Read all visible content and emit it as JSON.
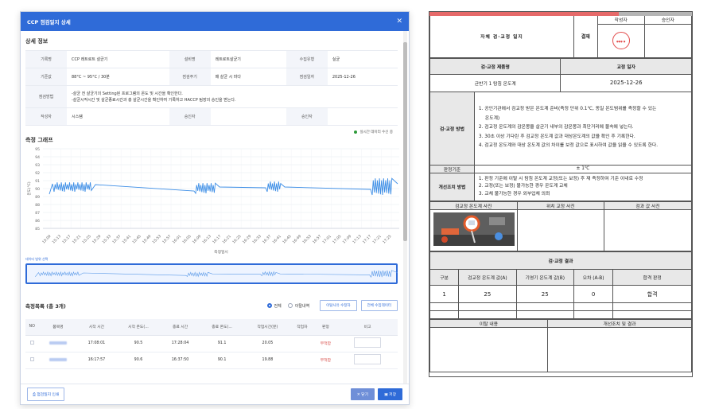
{
  "modal": {
    "title": "CCP 점검일지 상세",
    "close_icon": "close-icon",
    "detail_section": "상세 정보",
    "info": {
      "row1": [
        {
          "label": "기록명",
          "value": "CCP 레트로트 살균기"
        },
        {
          "label": "설비명",
          "value": "레트로트살균기"
        },
        {
          "label": "수집유형",
          "value": "실균"
        }
      ],
      "row2": [
        {
          "label": "기준값",
          "value": "88°C ~ 95°C / 30분"
        },
        {
          "label": "점검주기",
          "value": "매 살균 시 마다"
        },
        {
          "label": "점검일자",
          "value": "2025-12-26"
        }
      ],
      "row3": {
        "label": "점검방법",
        "lines": [
          "-살균 전 살균기의 Setting된 프로그램의 온도 및 시간을 확인한다.",
          "-살균시작시간 및 살균종료시간과 총 살균시간을 확인하여 기록하고 HACCP 팀장의 승인을 받는다."
        ]
      },
      "row4": [
        {
          "label": "작성자",
          "value": "시스템"
        },
        {
          "label": "승인자",
          "value": ""
        },
        {
          "label": "승인자",
          "value": ""
        }
      ]
    },
    "live_legend": "실시간 데이터 수신 중",
    "chart_section": "측정 그래프",
    "navigator_label": "데이터 범위 선택",
    "records_title": "측정목록 (총 3개)",
    "radio_all": "전체",
    "radio_abnormal": "이탈내역",
    "btn_abnormal_fix": "이탈사유 수정하",
    "btn_all_data": "전체 수집데이터",
    "table": {
      "headers": [
        "NO",
        "품목명",
        "시작 시간",
        "시작 온도(...",
        "종료 시간",
        "종료 온도(...",
        "작업시간(분)",
        "작업자",
        "판정",
        "비고"
      ],
      "rows": [
        {
          "start": "17:08:01",
          "start_temp": "90.5",
          "end": "17:28:04",
          "end_temp": "91.1",
          "minutes": "20.05",
          "worker": "",
          "result": "부적합"
        },
        {
          "start": "16:17:57",
          "start_temp": "90.6",
          "end": "16:37:50",
          "end_temp": "90.1",
          "minutes": "19.88",
          "worker": "",
          "result": "부적합"
        }
      ]
    },
    "footer": {
      "print": "점검일지 인쇄",
      "close": "✕ 닫기",
      "save": "저장"
    }
  },
  "chart_data": {
    "type": "line",
    "title": "",
    "xlabel": "측정일시",
    "ylabel": "온도(°C)",
    "ylim": [
      85,
      95
    ],
    "yticks": [
      85,
      86,
      87,
      88,
      89,
      90,
      91,
      92,
      93,
      94,
      95
    ],
    "x_ticks": [
      "15:09",
      "15:13",
      "15:17",
      "15:21",
      "15:25",
      "15:29",
      "15:33",
      "15:37",
      "15:41",
      "15:45",
      "15:49",
      "15:53",
      "15:57",
      "16:01",
      "16:05",
      "16:09",
      "16:13",
      "16:17",
      "16:21",
      "16:25",
      "16:29",
      "16:33",
      "16:37",
      "16:41",
      "16:45",
      "16:49",
      "16:53",
      "16:57",
      "17:01",
      "17:05",
      "17:09",
      "17:13",
      "17:17",
      "17:21",
      "17:25"
    ],
    "series": [
      {
        "name": "",
        "color": "#3d8ee6"
      }
    ],
    "grid": true
  },
  "document": {
    "title": "자체 검·교정 일지",
    "approval_label": "결재",
    "writer_label": "작성자",
    "approver_label": "승인자",
    "product_label": "검·교정 제품명",
    "date_label": "교정 일자",
    "product": "균반기 1 탐침 온도계",
    "date": "2025-12-26",
    "method_label": "검·교정 방법",
    "method_lines": [
      "1. 공인기관에서 검교정 받은 온도계 준비(측정 단위 0.1℃, 동일 온도범위를 측정할 수 있는",
      "온도계)",
      "2. 검교정 온도계의 감온봉을 살균기 내부의 감온봉과 최단거리에 물속에 넣는다.",
      "3. 30초 이상 기다린 후 검교정 온도계 값과 대상온도계의 값을 확인 후 기록한다.",
      "4. 검교정 온도계와 대상 온도계 값의 차이를 보정 값으로 표시하여 값을 읽을 수 있도록 한다."
    ],
    "criteria_label": "판정기준",
    "criteria_value": "± 1℃",
    "improve_label": "개선조치 방법",
    "improve_lines": [
      "1. 판정 기준에 이탈 시 탐침 온도계 교정(또는 보정) 후 재 측정하여 기준 이내로 수정",
      "2. 교정(또는 보정) 불가능한 경우 온도계 교체",
      "3. 교체 불가능한 경우 외부업체 의뢰"
    ],
    "photo_headers": [
      "검교정 온도계 사진",
      "위치 교정 사진",
      "검과 값 사진"
    ],
    "results_title": "검·교정 결과",
    "result_headers": [
      "구분",
      "검교정 온도계 값(A)",
      "기영기 온도계 값(B)",
      "오차 (A-B)",
      "합격 판정"
    ],
    "result_row": [
      "1",
      "25",
      "25",
      "0",
      "합격"
    ],
    "deviation_label": "이탈 내용",
    "action_label": "개선조치 및 결과"
  }
}
